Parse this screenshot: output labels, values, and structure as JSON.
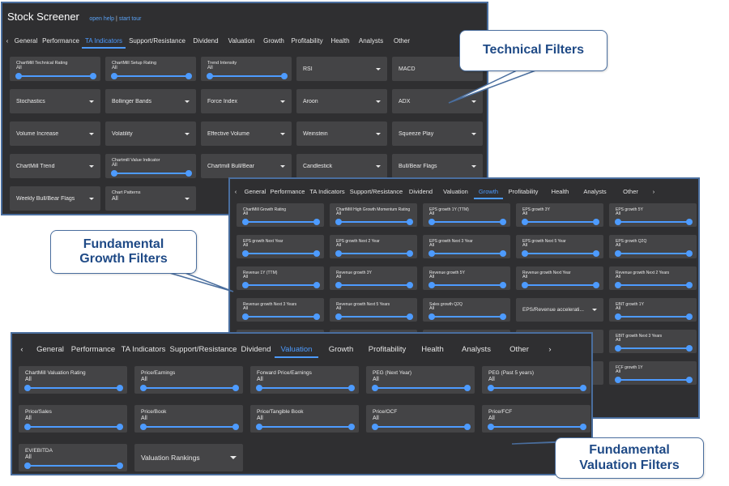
{
  "screener": {
    "title": "Stock Screener",
    "help_link": "open help",
    "separator": "|",
    "tour_link": "start tour"
  },
  "icons": {
    "left": "chevron-left-icon",
    "right": "chevron-right-icon",
    "dropdown": "caret-down-icon"
  },
  "colors": {
    "accent": "#4d9bff",
    "panel": "#2f2f31",
    "card": "#444446",
    "callout_text": "#1f4a86"
  },
  "ta_panel": {
    "prev": "‹",
    "tabs": [
      "General",
      "Performance",
      "TA Indicators",
      "Support/Resistance",
      "Dividend",
      "Valuation",
      "Growth",
      "Profitability",
      "Health",
      "Analysts",
      "Other"
    ],
    "active_tab": "TA Indicators",
    "filters": [
      {
        "type": "slider",
        "label": "ChartMill Technical Rating",
        "value": "All"
      },
      {
        "type": "slider",
        "label": "ChartMill Setup Rating",
        "value": "All"
      },
      {
        "type": "slider",
        "label": "Trend Intensity",
        "value": "All"
      },
      {
        "type": "dropdown",
        "label": "RSI"
      },
      {
        "type": "dropdown",
        "label": "MACD"
      },
      {
        "type": "dropdown",
        "label": "Stochastics"
      },
      {
        "type": "dropdown",
        "label": "Bollinger Bands"
      },
      {
        "type": "dropdown",
        "label": "Force Index"
      },
      {
        "type": "dropdown",
        "label": "Aroon"
      },
      {
        "type": "dropdown",
        "label": "ADX"
      },
      {
        "type": "dropdown",
        "label": "Volume Increase"
      },
      {
        "type": "dropdown",
        "label": "Volatility"
      },
      {
        "type": "dropdown",
        "label": "Effective Volume"
      },
      {
        "type": "dropdown",
        "label": "Weinstein"
      },
      {
        "type": "dropdown",
        "label": "Squeeze Play"
      },
      {
        "type": "dropdown",
        "label": "ChartMill Trend"
      },
      {
        "type": "slider",
        "label": "Chartmill Value Indicator",
        "value": "All"
      },
      {
        "type": "dropdown",
        "label": "Chartmill Bull/Bear"
      },
      {
        "type": "dropdown",
        "label": "Candlestick"
      },
      {
        "type": "dropdown",
        "label": "Bull/Bear Flags"
      },
      {
        "type": "dropdown",
        "label": "Weekly Bull/Bear Flags"
      },
      {
        "type": "pattern",
        "label": "Chart Patterns",
        "value": "All"
      }
    ]
  },
  "growth_panel": {
    "prev": "‹",
    "next": "›",
    "tabs": [
      "General",
      "Performance",
      "TA Indicators",
      "Support/Resistance",
      "Dividend",
      "Valuation",
      "Growth",
      "Profitability",
      "Health",
      "Analysts",
      "Other"
    ],
    "active_tab": "Growth",
    "filters": [
      {
        "type": "slider",
        "label": "ChartMill Growth Rating",
        "value": "All"
      },
      {
        "type": "slider",
        "label": "ChartMill High Growth Momentum Rating",
        "value": "All"
      },
      {
        "type": "slider",
        "label": "EPS growth 1Y (TTM)",
        "value": "All"
      },
      {
        "type": "slider",
        "label": "EPS growth 3Y",
        "value": "All"
      },
      {
        "type": "slider",
        "label": "EPS growth 5Y",
        "value": "All"
      },
      {
        "type": "slider",
        "label": "EPS growth Next Year",
        "value": "All"
      },
      {
        "type": "slider",
        "label": "EPS growth Next 2 Year",
        "value": "All"
      },
      {
        "type": "slider",
        "label": "EPS growth Next 3 Year",
        "value": "All"
      },
      {
        "type": "slider",
        "label": "EPS growth Next 5 Year",
        "value": "All"
      },
      {
        "type": "slider",
        "label": "EPS growth Q2Q",
        "value": "All"
      },
      {
        "type": "slider",
        "label": "Revenue 1Y (TTM)",
        "value": "All"
      },
      {
        "type": "slider",
        "label": "Revenue growth 3Y",
        "value": "All"
      },
      {
        "type": "slider",
        "label": "Revenue growth 5Y",
        "value": "All"
      },
      {
        "type": "slider",
        "label": "Revenue growth Next Year",
        "value": "All"
      },
      {
        "type": "slider",
        "label": "Revenue growth Next 2 Years",
        "value": "All"
      },
      {
        "type": "slider",
        "label": "Revenue growth Next 3 Years",
        "value": "All"
      },
      {
        "type": "slider",
        "label": "Revenue growth Next 5 Years",
        "value": "All"
      },
      {
        "type": "slider",
        "label": "Sales growth Q2Q",
        "value": "All"
      },
      {
        "type": "dropdown",
        "label": "EPS/Revenue accelerati..."
      },
      {
        "type": "slider",
        "label": "EBIT growth 1Y",
        "value": "All"
      },
      {
        "type": "empty"
      },
      {
        "type": "empty"
      },
      {
        "type": "empty"
      },
      {
        "type": "empty"
      },
      {
        "type": "slider",
        "label": "EBIT growth Next 3 Years",
        "value": "All"
      },
      {
        "type": "empty"
      },
      {
        "type": "empty"
      },
      {
        "type": "empty"
      },
      {
        "type": "empty"
      },
      {
        "type": "slider",
        "label": "FCF growth 1Y",
        "value": "All"
      }
    ]
  },
  "valuation_panel": {
    "prev": "‹",
    "next": "›",
    "tabs": [
      "General",
      "Performance",
      "TA Indicators",
      "Support/Resistance",
      "Dividend",
      "Valuation",
      "Growth",
      "Profitability",
      "Health",
      "Analysts",
      "Other"
    ],
    "active_tab": "Valuation",
    "filters": [
      {
        "type": "slider",
        "label": "ChartMill Valuation Rating",
        "value": "All"
      },
      {
        "type": "slider",
        "label": "Price/Earnings",
        "value": "All"
      },
      {
        "type": "slider",
        "label": "Forward Price/Earnings",
        "value": "All"
      },
      {
        "type": "slider",
        "label": "PEG (Next Year)",
        "value": "All"
      },
      {
        "type": "slider",
        "label": "PEG (Past 5 years)",
        "value": "All"
      },
      {
        "type": "slider",
        "label": "Price/Sales",
        "value": "All"
      },
      {
        "type": "slider",
        "label": "Price/Book",
        "value": "All"
      },
      {
        "type": "slider",
        "label": "Price/Tangible Book",
        "value": "All"
      },
      {
        "type": "slider",
        "label": "Price/OCF",
        "value": "All"
      },
      {
        "type": "slider",
        "label": "Price/FCF",
        "value": "All"
      },
      {
        "type": "slider",
        "label": "EV/EBITDA",
        "value": "All"
      },
      {
        "type": "dropdown",
        "label": "Valuation Rankings"
      }
    ]
  },
  "callouts": {
    "technical": [
      "Technical Filters"
    ],
    "growth": [
      "Fundamental",
      "Growth Filters"
    ],
    "valuation": [
      "Fundamental",
      "Valuation Filters"
    ]
  }
}
